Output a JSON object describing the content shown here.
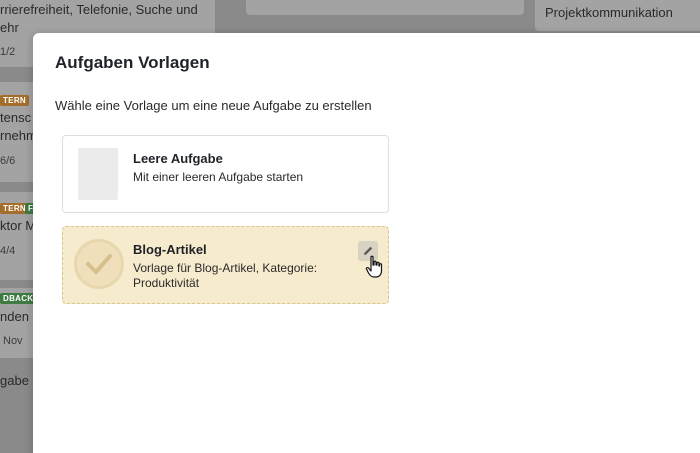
{
  "background": {
    "card1_title_line1": "rrierefreiheit, Telefonie, Suche und",
    "card1_title_line2": "ehr",
    "card1_meta": "1/2",
    "card2_tag": "TERN",
    "card2_title_line1": "tensc",
    "card2_title_line2": "rnehm",
    "card2_meta": "6/6",
    "card3_tag1": "TERN",
    "card3_tag2": "F",
    "card3_title": "ktor M",
    "card3_meta": "4/4",
    "card4_tag": "DBACK",
    "card4_title": "nden",
    "card4_meta": "Nov",
    "add_task_partial": "gabe",
    "right_card_title": "Projektkommunikation"
  },
  "modal": {
    "title": "Aufgaben Vorlagen",
    "subtitle": "Wähle eine Vorlage um eine neue Aufgabe zu erstellen",
    "templates": [
      {
        "name": "Leere Aufgabe",
        "description": "Mit einer leeren Aufgabe starten"
      },
      {
        "name": "Blog-Artikel",
        "description": "Vorlage für Blog-Artikel, Kategorie: Produktivität"
      }
    ]
  },
  "icons": {
    "blog_thumb": "check-icon",
    "edit": "pencil-icon",
    "cursor": "hand-pointer-icon"
  },
  "colors": {
    "highlight_bg": "#f7ebcd",
    "highlight_border": "#d9c48e"
  }
}
